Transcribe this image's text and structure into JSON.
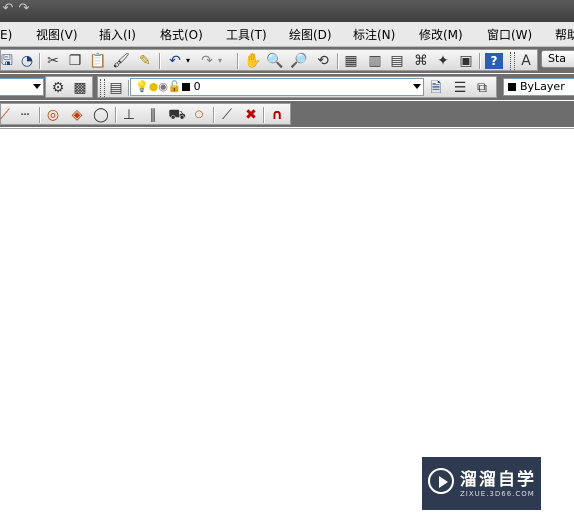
{
  "menu": {
    "items": [
      "E)",
      "视图(V)",
      "插入(I)",
      "格式(O)",
      "工具(T)",
      "绘图(D)",
      "标注(N)",
      "修改(M)",
      "窗口(W)",
      "帮助"
    ]
  },
  "layers": {
    "current_layer": "0"
  },
  "properties": {
    "color": "ByLayer"
  },
  "text_style": {
    "label": "Sta"
  },
  "watermark": {
    "title": "溜溜自学",
    "url": "ZIXUE.3D66.COM"
  },
  "icons": {
    "quick_access": [
      "undo-icon",
      "redo-icon"
    ],
    "standard": [
      "save-as-icon",
      "publish-icon",
      "cut-icon",
      "copy-icon",
      "paste-icon",
      "match-properties-icon",
      "block-editor-icon",
      "undo-icon",
      "redo-icon",
      "pan-icon",
      "zoom-realtime-icon",
      "zoom-window-icon",
      "zoom-previous-icon",
      "properties-icon",
      "design-center-icon",
      "tool-palettes-icon",
      "sheet-set-icon",
      "markup-icon",
      "quickcalc-icon",
      "help-icon",
      "text-style-icon"
    ],
    "layers": [
      "layer-settings-icon",
      "layer-states-icon",
      "layer-properties-icon",
      "make-current-icon",
      "layer-previous-icon",
      "layer-iso-icon"
    ],
    "osnap": [
      "tangent-icon",
      "extension-icon",
      "center-icon",
      "quadrant-icon",
      "tangent-circle-icon",
      "perpendicular-icon",
      "parallel-icon",
      "insert-icon",
      "node-icon",
      "nearest-icon",
      "none-icon",
      "snap-settings-icon"
    ]
  },
  "colors": {
    "title_bar": "#4a4a4a",
    "menu_bar": "#e9e9e9",
    "toolbar_bg": "#6d6d6d",
    "canvas": "#ffffff",
    "watermark_bg": "#2e3a4f"
  }
}
